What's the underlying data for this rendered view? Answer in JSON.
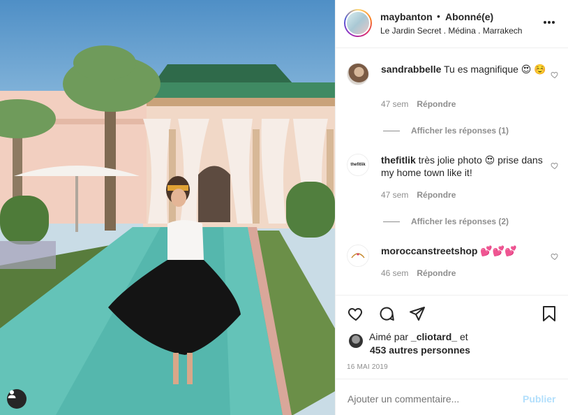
{
  "post": {
    "author": "maybanton",
    "separator": "•",
    "follow_status": "Abonné(e)",
    "location": "Le Jardin Secret . Médina . Marrakech",
    "more_icon": "more-horizontal-icon"
  },
  "comments": [
    {
      "user": "sandrabbelle",
      "text": "Tu es magnifique 😍 ☺️",
      "age": "47 sem",
      "reply": "Répondre",
      "replies": null
    },
    {
      "user": "thefitlik",
      "text": "très jolie photo 😍 prise dans my home town like it!",
      "age": "47 sem",
      "reply": "Répondre",
      "replies": "Afficher les réponses (1)"
    },
    {
      "user": "moroccanstreetshop",
      "text": "💕💕💕",
      "age": "46 sem",
      "reply": "Répondre",
      "replies": "Afficher les réponses (2)"
    }
  ],
  "avatars": {
    "thefitlik_logo": "thefitlik"
  },
  "likes": {
    "prefix": "Aimé par",
    "user": "_cliotard_",
    "suffix": "et",
    "others": "453 autres personnes"
  },
  "date": "16 MAI 2019",
  "add_comment": {
    "placeholder": "Ajouter un commentaire...",
    "publish": "Publier"
  },
  "colors": {
    "text": "#262626",
    "muted": "#8e8e8e",
    "publish_disabled": "#b2dffc",
    "border": "#efefef"
  }
}
